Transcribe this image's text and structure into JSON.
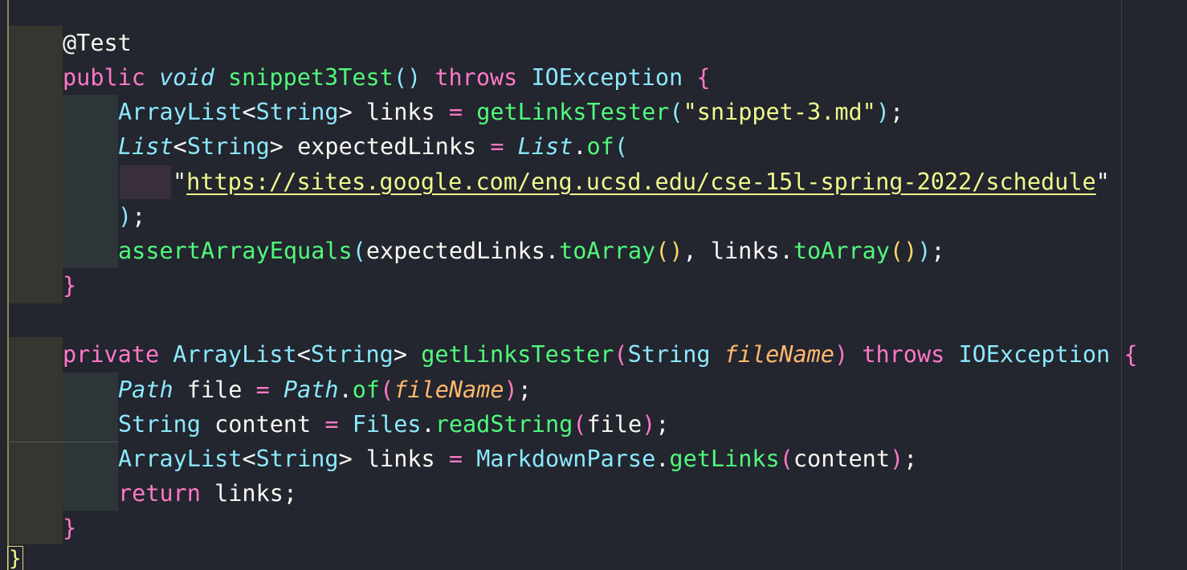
{
  "code": {
    "annotation": "@Test",
    "method1": {
      "kw_public": "public",
      "void": "void",
      "name": "snippet3Test",
      "parens": "()",
      "kw_throws": "throws",
      "exception": "IOException",
      "open_brace": "{",
      "line1_type": "ArrayList",
      "line1_generic_open": "<",
      "line1_generic_type": "String",
      "line1_generic_close": ">",
      "line1_var": " links ",
      "line1_eq": "=",
      "line1_fn": "getLinksTester",
      "line1_paren_open": "(",
      "line1_str": "\"snippet-3.md\"",
      "line1_paren_close": ")",
      "line1_semi": ";",
      "line2_type": "List",
      "line2_generic_open": "<",
      "line2_generic_type": "String",
      "line2_generic_close": ">",
      "line2_var": " expectedLinks ",
      "line2_eq": "=",
      "line2_class": "List",
      "line2_dot": ".",
      "line2_fn": "of",
      "line2_paren_open": "(",
      "line3_quote_open": "\"",
      "line3_url": "https://sites.google.com/eng.ucsd.edu/cse-15l-spring-2022/schedule",
      "line3_quote_close": "\"",
      "line4_paren_close": ")",
      "line4_semi": ";",
      "line5_fn": "assertArrayEquals",
      "line5_paren_open": "(",
      "line5_arg1": "expectedLinks.",
      "line5_fn2": "toArray",
      "line5_parens2": "()",
      "line5_comma": ", links.",
      "line5_fn3": "toArray",
      "line5_parens3": "()",
      "line5_paren_close": ")",
      "line5_semi": ";",
      "close_brace": "}"
    },
    "method2": {
      "kw_private": "private",
      "type": "ArrayList",
      "generic_open": "<",
      "generic_type": "String",
      "generic_close": ">",
      "name": "getLinksTester",
      "paren_open": "(",
      "param_type": "String",
      "param_name": "fileName",
      "paren_close": ")",
      "kw_throws": "throws",
      "exception": "IOException",
      "open_brace": "{",
      "line1_type": "Path",
      "line1_var": " file ",
      "line1_eq": "=",
      "line1_class": "Path",
      "line1_dot": ".",
      "line1_fn": "of",
      "line1_paren_open": "(",
      "line1_arg": "fileName",
      "line1_paren_close": ")",
      "line1_semi": ";",
      "line2_type": "String",
      "line2_var": " content ",
      "line2_eq": "=",
      "line2_class": "Files",
      "line2_dot": ".",
      "line2_fn": "readString",
      "line2_paren_open": "(",
      "line2_arg": "file",
      "line2_paren_close": ")",
      "line2_semi": ";",
      "line3_type": "ArrayList",
      "line3_generic_open": "<",
      "line3_generic_type": "String",
      "line3_generic_close": ">",
      "line3_var": " links ",
      "line3_eq": "=",
      "line3_class": "MarkdownParse",
      "line3_dot": ".",
      "line3_fn": "getLinks",
      "line3_paren_open": "(",
      "line3_arg": "content",
      "line3_paren_close": ")",
      "line3_semi": ";",
      "line4_kw": "return",
      "line4_rest": " links;",
      "close_brace": "}"
    },
    "final_brace": "}"
  },
  "colors": {
    "background": "#23252f",
    "keyword": "#ff79c6",
    "type": "#8be9fd",
    "function": "#50fa7b",
    "string": "#f1fa8c",
    "parameter": "#ffb86c",
    "text": "#f8f8f2"
  }
}
